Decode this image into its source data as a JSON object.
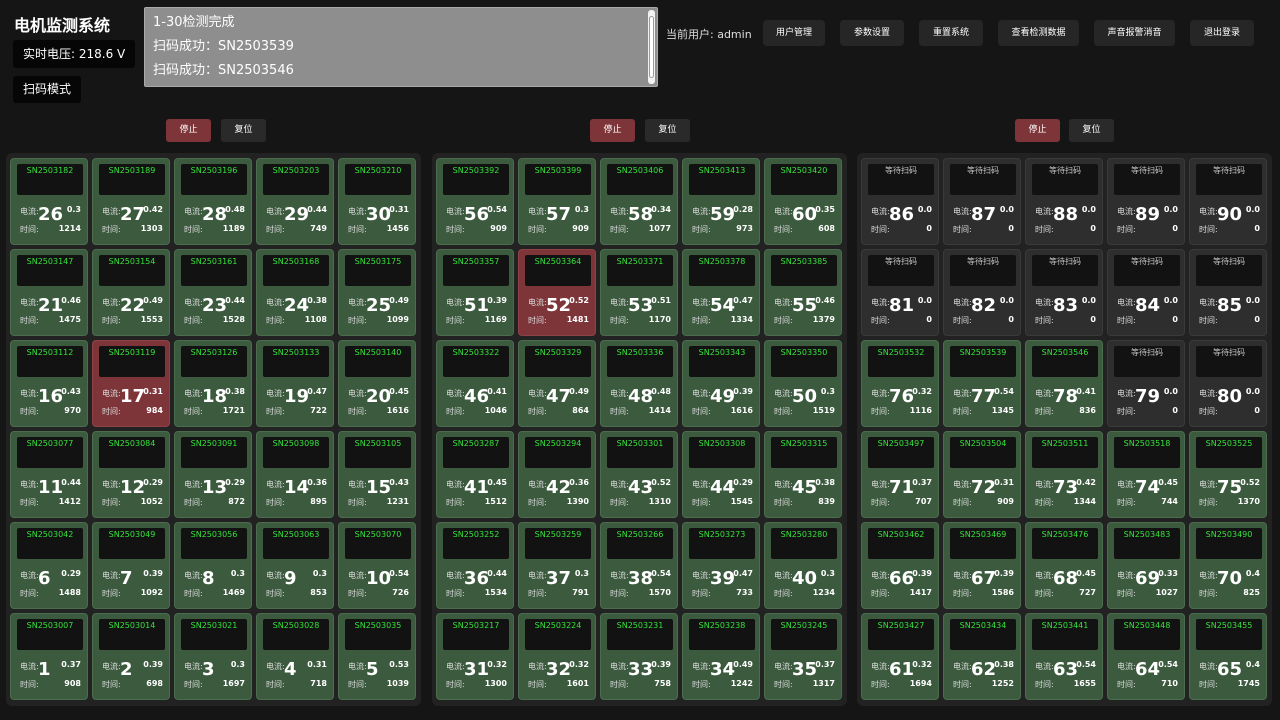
{
  "header": {
    "title": "电机监测系统",
    "voltage_label": "实时电压: 218.6 V",
    "mode_label": "扫码模式",
    "user_label": "当前用户: admin"
  },
  "log": {
    "lines": [
      "1-30检测完成",
      "扫码成功：SN2503539",
      "扫码成功：SN2503546"
    ]
  },
  "toolbar": {
    "user_mgmt": "用户管理",
    "params": "参数设置",
    "reset_system": "重置系统",
    "view_data": "查看检测数据",
    "mute_alarm": "声音报警消音",
    "logout": "退出登录"
  },
  "controls": {
    "stop": "停止",
    "reset": "复位"
  },
  "labels": {
    "current": "电流:",
    "time": "时间:",
    "waiting": "等待扫码"
  },
  "colors": {
    "normal": "#3b5a3e",
    "alarm": "#7d3539",
    "waiting": "#2e2e2e",
    "sn_text": "#35e23b"
  },
  "panels": [
    {
      "rows": [
        [
          {
            "n": 26,
            "sn": "SN2503182",
            "cur": "0.3",
            "time": "1214"
          },
          {
            "n": 27,
            "sn": "SN2503189",
            "cur": "0.42",
            "time": "1303"
          },
          {
            "n": 28,
            "sn": "SN2503196",
            "cur": "0.48",
            "time": "1189"
          },
          {
            "n": 29,
            "sn": "SN2503203",
            "cur": "0.44",
            "time": "749"
          },
          {
            "n": 30,
            "sn": "SN2503210",
            "cur": "0.31",
            "time": "1456"
          }
        ],
        [
          {
            "n": 21,
            "sn": "SN2503147",
            "cur": "0.46",
            "time": "1475"
          },
          {
            "n": 22,
            "sn": "SN2503154",
            "cur": "0.49",
            "time": "1553"
          },
          {
            "n": 23,
            "sn": "SN2503161",
            "cur": "0.44",
            "time": "1528"
          },
          {
            "n": 24,
            "sn": "SN2503168",
            "cur": "0.38",
            "time": "1108"
          },
          {
            "n": 25,
            "sn": "SN2503175",
            "cur": "0.49",
            "time": "1099"
          }
        ],
        [
          {
            "n": 16,
            "sn": "SN2503112",
            "cur": "0.43",
            "time": "970"
          },
          {
            "n": 17,
            "sn": "SN2503119",
            "cur": "0.31",
            "time": "984",
            "state": "alarm"
          },
          {
            "n": 18,
            "sn": "SN2503126",
            "cur": "0.38",
            "time": "1721"
          },
          {
            "n": 19,
            "sn": "SN2503133",
            "cur": "0.47",
            "time": "722"
          },
          {
            "n": 20,
            "sn": "SN2503140",
            "cur": "0.45",
            "time": "1616"
          }
        ],
        [
          {
            "n": 11,
            "sn": "SN2503077",
            "cur": "0.44",
            "time": "1412"
          },
          {
            "n": 12,
            "sn": "SN2503084",
            "cur": "0.29",
            "time": "1052"
          },
          {
            "n": 13,
            "sn": "SN2503091",
            "cur": "0.29",
            "time": "872"
          },
          {
            "n": 14,
            "sn": "SN2503098",
            "cur": "0.36",
            "time": "895"
          },
          {
            "n": 15,
            "sn": "SN2503105",
            "cur": "0.43",
            "time": "1231"
          }
        ],
        [
          {
            "n": 6,
            "sn": "SN2503042",
            "cur": "0.29",
            "time": "1488"
          },
          {
            "n": 7,
            "sn": "SN2503049",
            "cur": "0.39",
            "time": "1092"
          },
          {
            "n": 8,
            "sn": "SN2503056",
            "cur": "0.3",
            "time": "1469"
          },
          {
            "n": 9,
            "sn": "SN2503063",
            "cur": "0.3",
            "time": "853"
          },
          {
            "n": 10,
            "sn": "SN2503070",
            "cur": "0.54",
            "time": "726"
          }
        ],
        [
          {
            "n": 1,
            "sn": "SN2503007",
            "cur": "0.37",
            "time": "908"
          },
          {
            "n": 2,
            "sn": "SN2503014",
            "cur": "0.39",
            "time": "698"
          },
          {
            "n": 3,
            "sn": "SN2503021",
            "cur": "0.3",
            "time": "1697"
          },
          {
            "n": 4,
            "sn": "SN2503028",
            "cur": "0.31",
            "time": "718"
          },
          {
            "n": 5,
            "sn": "SN2503035",
            "cur": "0.53",
            "time": "1039"
          }
        ]
      ]
    },
    {
      "rows": [
        [
          {
            "n": 56,
            "sn": "SN2503392",
            "cur": "0.54",
            "time": "909"
          },
          {
            "n": 57,
            "sn": "SN2503399",
            "cur": "0.3",
            "time": "909"
          },
          {
            "n": 58,
            "sn": "SN2503406",
            "cur": "0.34",
            "time": "1077"
          },
          {
            "n": 59,
            "sn": "SN2503413",
            "cur": "0.28",
            "time": "973"
          },
          {
            "n": 60,
            "sn": "SN2503420",
            "cur": "0.35",
            "time": "608"
          }
        ],
        [
          {
            "n": 51,
            "sn": "SN2503357",
            "cur": "0.39",
            "time": "1169"
          },
          {
            "n": 52,
            "sn": "SN2503364",
            "cur": "0.52",
            "time": "1481",
            "state": "alarm"
          },
          {
            "n": 53,
            "sn": "SN2503371",
            "cur": "0.51",
            "time": "1170"
          },
          {
            "n": 54,
            "sn": "SN2503378",
            "cur": "0.47",
            "time": "1334"
          },
          {
            "n": 55,
            "sn": "SN2503385",
            "cur": "0.46",
            "time": "1379"
          }
        ],
        [
          {
            "n": 46,
            "sn": "SN2503322",
            "cur": "0.41",
            "time": "1046"
          },
          {
            "n": 47,
            "sn": "SN2503329",
            "cur": "0.49",
            "time": "864"
          },
          {
            "n": 48,
            "sn": "SN2503336",
            "cur": "0.48",
            "time": "1414"
          },
          {
            "n": 49,
            "sn": "SN2503343",
            "cur": "0.39",
            "time": "1616"
          },
          {
            "n": 50,
            "sn": "SN2503350",
            "cur": "0.3",
            "time": "1519"
          }
        ],
        [
          {
            "n": 41,
            "sn": "SN2503287",
            "cur": "0.45",
            "time": "1512"
          },
          {
            "n": 42,
            "sn": "SN2503294",
            "cur": "0.36",
            "time": "1390"
          },
          {
            "n": 43,
            "sn": "SN2503301",
            "cur": "0.52",
            "time": "1310"
          },
          {
            "n": 44,
            "sn": "SN2503308",
            "cur": "0.29",
            "time": "1545"
          },
          {
            "n": 45,
            "sn": "SN2503315",
            "cur": "0.38",
            "time": "839"
          }
        ],
        [
          {
            "n": 36,
            "sn": "SN2503252",
            "cur": "0.44",
            "time": "1534"
          },
          {
            "n": 37,
            "sn": "SN2503259",
            "cur": "0.3",
            "time": "791"
          },
          {
            "n": 38,
            "sn": "SN2503266",
            "cur": "0.54",
            "time": "1570"
          },
          {
            "n": 39,
            "sn": "SN2503273",
            "cur": "0.47",
            "time": "733"
          },
          {
            "n": 40,
            "sn": "SN2503280",
            "cur": "0.3",
            "time": "1234"
          }
        ],
        [
          {
            "n": 31,
            "sn": "SN2503217",
            "cur": "0.32",
            "time": "1300"
          },
          {
            "n": 32,
            "sn": "SN2503224",
            "cur": "0.32",
            "time": "1601"
          },
          {
            "n": 33,
            "sn": "SN2503231",
            "cur": "0.39",
            "time": "758"
          },
          {
            "n": 34,
            "sn": "SN2503238",
            "cur": "0.49",
            "time": "1242"
          },
          {
            "n": 35,
            "sn": "SN2503245",
            "cur": "0.37",
            "time": "1317"
          }
        ]
      ]
    },
    {
      "rows": [
        [
          {
            "n": 86,
            "sn": "等待扫码",
            "cur": "0.0",
            "time": "0",
            "state": "waiting"
          },
          {
            "n": 87,
            "sn": "等待扫码",
            "cur": "0.0",
            "time": "0",
            "state": "waiting"
          },
          {
            "n": 88,
            "sn": "等待扫码",
            "cur": "0.0",
            "time": "0",
            "state": "waiting"
          },
          {
            "n": 89,
            "sn": "等待扫码",
            "cur": "0.0",
            "time": "0",
            "state": "waiting"
          },
          {
            "n": 90,
            "sn": "等待扫码",
            "cur": "0.0",
            "time": "0",
            "state": "waiting"
          }
        ],
        [
          {
            "n": 81,
            "sn": "等待扫码",
            "cur": "0.0",
            "time": "0",
            "state": "waiting"
          },
          {
            "n": 82,
            "sn": "等待扫码",
            "cur": "0.0",
            "time": "0",
            "state": "waiting"
          },
          {
            "n": 83,
            "sn": "等待扫码",
            "cur": "0.0",
            "time": "0",
            "state": "waiting"
          },
          {
            "n": 84,
            "sn": "等待扫码",
            "cur": "0.0",
            "time": "0",
            "state": "waiting"
          },
          {
            "n": 85,
            "sn": "等待扫码",
            "cur": "0.0",
            "time": "0",
            "state": "waiting"
          }
        ],
        [
          {
            "n": 76,
            "sn": "SN2503532",
            "cur": "0.32",
            "time": "1116"
          },
          {
            "n": 77,
            "sn": "SN2503539",
            "cur": "0.54",
            "time": "1345"
          },
          {
            "n": 78,
            "sn": "SN2503546",
            "cur": "0.41",
            "time": "836"
          },
          {
            "n": 79,
            "sn": "等待扫码",
            "cur": "0.0",
            "time": "0",
            "state": "waiting"
          },
          {
            "n": 80,
            "sn": "等待扫码",
            "cur": "0.0",
            "time": "0",
            "state": "waiting"
          }
        ],
        [
          {
            "n": 71,
            "sn": "SN2503497",
            "cur": "0.37",
            "time": "707"
          },
          {
            "n": 72,
            "sn": "SN2503504",
            "cur": "0.31",
            "time": "909"
          },
          {
            "n": 73,
            "sn": "SN2503511",
            "cur": "0.42",
            "time": "1344"
          },
          {
            "n": 74,
            "sn": "SN2503518",
            "cur": "0.45",
            "time": "744"
          },
          {
            "n": 75,
            "sn": "SN2503525",
            "cur": "0.52",
            "time": "1370"
          }
        ],
        [
          {
            "n": 66,
            "sn": "SN2503462",
            "cur": "0.39",
            "time": "1417"
          },
          {
            "n": 67,
            "sn": "SN2503469",
            "cur": "0.39",
            "time": "1586"
          },
          {
            "n": 68,
            "sn": "SN2503476",
            "cur": "0.45",
            "time": "727"
          },
          {
            "n": 69,
            "sn": "SN2503483",
            "cur": "0.33",
            "time": "1027"
          },
          {
            "n": 70,
            "sn": "SN2503490",
            "cur": "0.4",
            "time": "825"
          }
        ],
        [
          {
            "n": 61,
            "sn": "SN2503427",
            "cur": "0.32",
            "time": "1694"
          },
          {
            "n": 62,
            "sn": "SN2503434",
            "cur": "0.38",
            "time": "1252"
          },
          {
            "n": 63,
            "sn": "SN2503441",
            "cur": "0.54",
            "time": "1655"
          },
          {
            "n": 64,
            "sn": "SN2503448",
            "cur": "0.54",
            "time": "710"
          },
          {
            "n": 65,
            "sn": "SN2503455",
            "cur": "0.4",
            "time": "1745"
          }
        ]
      ]
    }
  ]
}
